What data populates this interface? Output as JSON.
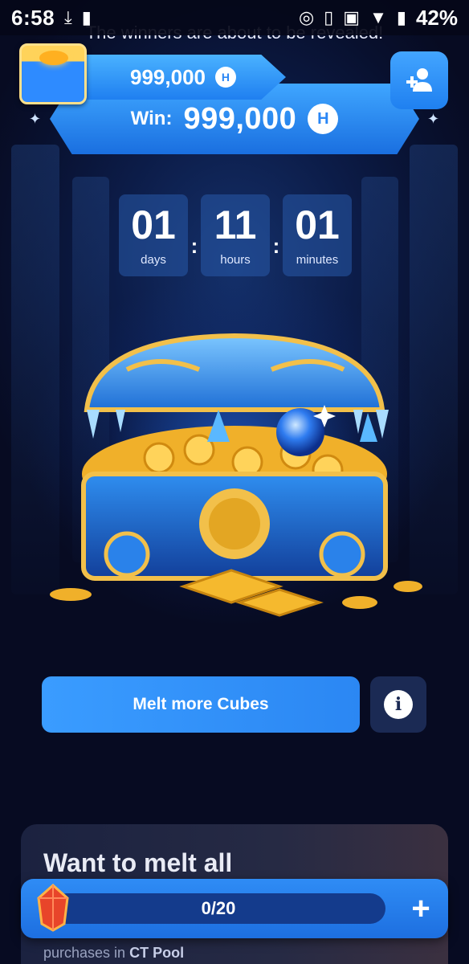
{
  "status_bar": {
    "time": "6:58",
    "battery": "42%",
    "icons": [
      "download-icon",
      "sd-card-icon",
      "nfc-icon",
      "vibrate-icon",
      "voicemail-icon",
      "wifi-icon",
      "battery-icon"
    ]
  },
  "header": {
    "reveal_text": "The winners are about to be revealed!",
    "balance": "999,000",
    "win_label": "Win:",
    "win_value": "999,000",
    "coin_symbol": "H"
  },
  "countdown": {
    "days": {
      "value": "01",
      "label": "days"
    },
    "hours": {
      "value": "11",
      "label": "hours"
    },
    "minutes": {
      "value": "01",
      "label": "minutes"
    },
    "separator": ":"
  },
  "actions": {
    "melt_button": "Melt more Cubes"
  },
  "promo": {
    "title": "Want to melt all",
    "subtitle_prefix": "purchases in",
    "subtitle_bold": "CT Pool"
  },
  "progress": {
    "text": "0/20",
    "current": 0,
    "total": 20
  },
  "colors": {
    "accent": "#2b87f3",
    "background": "#070b22",
    "gold": "#f5b92e"
  }
}
